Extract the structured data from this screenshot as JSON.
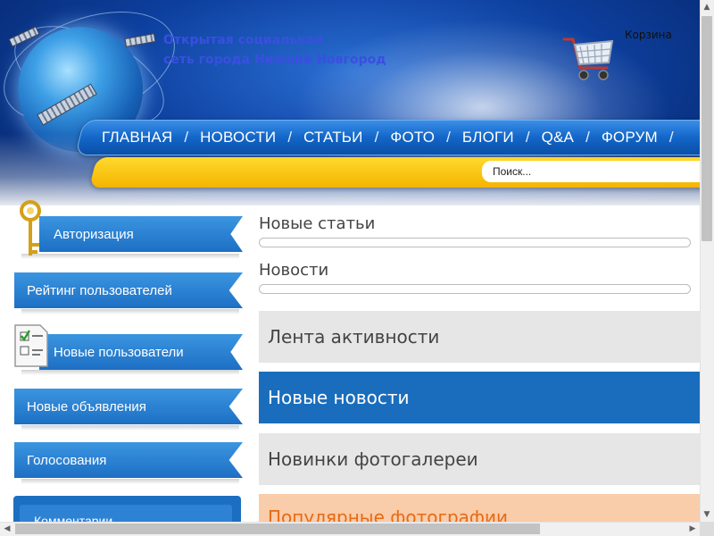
{
  "header": {
    "title_line1": "Открытая социальная",
    "title_line2": "сеть города Нижний Новгород",
    "cart_label": "Корзина"
  },
  "nav": {
    "items": [
      "ГЛАВНАЯ",
      "НОВОСТИ",
      "СТАТЬИ",
      "ФОТО",
      "БЛОГИ",
      "Q&A",
      "ФОРУМ"
    ],
    "separator": "/"
  },
  "search": {
    "placeholder": "Поиск..."
  },
  "sidebar": {
    "items": [
      "Авторизация",
      "Рейтинг пользователей",
      "Новые пользователи",
      "Новые объявления",
      "Голосования"
    ],
    "bottom_box_label": "Комментарии"
  },
  "main": {
    "sections": [
      "Новые статьи",
      "Новости"
    ],
    "tabs": [
      {
        "label": "Лента активности",
        "style": "gray"
      },
      {
        "label": "Новые новости",
        "style": "blue"
      },
      {
        "label": "Новинки фотогалереи",
        "style": "gray"
      },
      {
        "label": "Популярные фотографии",
        "style": "orange"
      }
    ]
  },
  "colors": {
    "nav_blue": "#1366c8",
    "search_bar_yellow": "#f4b400",
    "tab_active_blue": "#1a6dbc",
    "tab_gray": "#e6e6e6",
    "tab_orange_bg": "#f9ccaa",
    "tab_orange_text": "#e86a12",
    "title_text": "#3a4fe0"
  },
  "icons": [
    "globe-satellite-logo",
    "shopping-cart-icon",
    "golden-key-icon",
    "checklist-icon"
  ]
}
